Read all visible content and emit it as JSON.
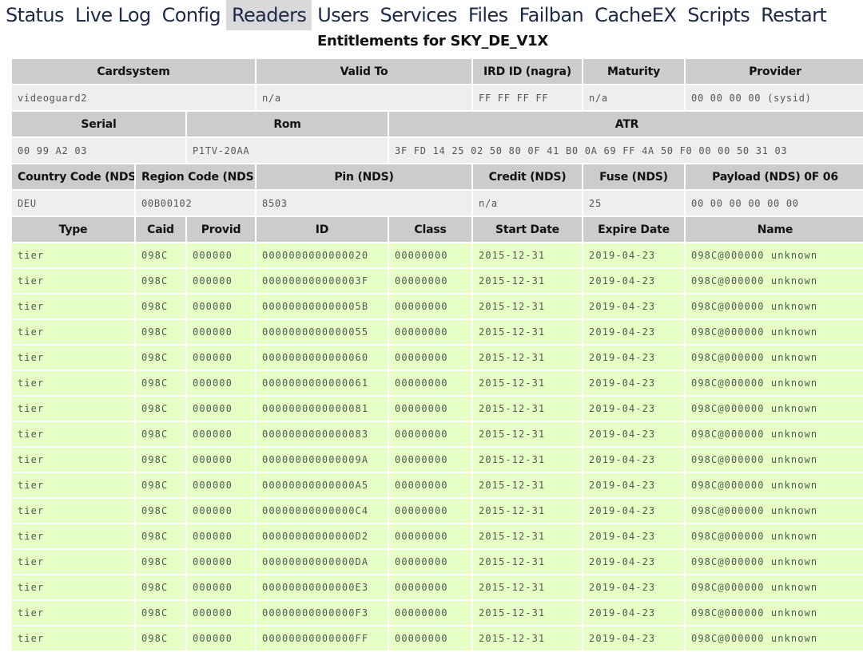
{
  "menu": [
    {
      "label": "Status",
      "active": false
    },
    {
      "label": "Live Log",
      "active": false
    },
    {
      "label": "Config",
      "active": false
    },
    {
      "label": "Readers",
      "active": true
    },
    {
      "label": "Users",
      "active": false
    },
    {
      "label": "Services",
      "active": false
    },
    {
      "label": "Files",
      "active": false
    },
    {
      "label": "Failban",
      "active": false
    },
    {
      "label": "CacheEX",
      "active": false
    },
    {
      "label": "Scripts",
      "active": false
    },
    {
      "label": "Restart",
      "active": false
    }
  ],
  "title": "Entitlements for SKY_DE_V1X",
  "card_info": {
    "h_cardsystem": "Cardsystem",
    "h_valid_to": "Valid To",
    "h_ird_id": "IRD ID (nagra)",
    "h_maturity": "Maturity",
    "h_provider": "Provider",
    "cardsystem": "videoguard2",
    "valid_to": "n/a",
    "ird_id": "FF FF FF FF",
    "maturity": "n/a",
    "provider": "00 00 00 00 (sysid)",
    "h_serial": "Serial",
    "h_rom": "Rom",
    "h_atr": "ATR",
    "serial": "00 99 A2 03",
    "rom": "P1TV-20AA",
    "atr": "3F FD 14 25 02 50 80 0F 41 B0 0A 69 FF 4A 50 F0 00 00 50 31 03",
    "h_country": "Country Code (NDS)",
    "h_region": "Region Code (NDS)",
    "h_pin": "Pin (NDS)",
    "h_credit": "Credit (NDS)",
    "h_fuse": "Fuse (NDS)",
    "h_payload": "Payload (NDS) 0F 06",
    "country": "DEU",
    "region": "00B00102",
    "pin": "8503",
    "credit": "n/a",
    "fuse": "25",
    "payload": "00 00 00 00 00 00"
  },
  "entitlements": {
    "columns": [
      "Type",
      "Caid",
      "Provid",
      "ID",
      "Class",
      "Start Date",
      "Expire Date",
      "Name"
    ],
    "rows": [
      [
        "tier",
        "098C",
        "000000",
        "0000000000000020",
        "00000000",
        "2015-12-31",
        "2019-04-23",
        "098C@000000 unknown"
      ],
      [
        "tier",
        "098C",
        "000000",
        "000000000000003F",
        "00000000",
        "2015-12-31",
        "2019-04-23",
        "098C@000000 unknown"
      ],
      [
        "tier",
        "098C",
        "000000",
        "000000000000005B",
        "00000000",
        "2015-12-31",
        "2019-04-23",
        "098C@000000 unknown"
      ],
      [
        "tier",
        "098C",
        "000000",
        "0000000000000055",
        "00000000",
        "2015-12-31",
        "2019-04-23",
        "098C@000000 unknown"
      ],
      [
        "tier",
        "098C",
        "000000",
        "0000000000000060",
        "00000000",
        "2015-12-31",
        "2019-04-23",
        "098C@000000 unknown"
      ],
      [
        "tier",
        "098C",
        "000000",
        "0000000000000061",
        "00000000",
        "2015-12-31",
        "2019-04-23",
        "098C@000000 unknown"
      ],
      [
        "tier",
        "098C",
        "000000",
        "0000000000000081",
        "00000000",
        "2015-12-31",
        "2019-04-23",
        "098C@000000 unknown"
      ],
      [
        "tier",
        "098C",
        "000000",
        "0000000000000083",
        "00000000",
        "2015-12-31",
        "2019-04-23",
        "098C@000000 unknown"
      ],
      [
        "tier",
        "098C",
        "000000",
        "000000000000009A",
        "00000000",
        "2015-12-31",
        "2019-04-23",
        "098C@000000 unknown"
      ],
      [
        "tier",
        "098C",
        "000000",
        "00000000000000A5",
        "00000000",
        "2015-12-31",
        "2019-04-23",
        "098C@000000 unknown"
      ],
      [
        "tier",
        "098C",
        "000000",
        "00000000000000C4",
        "00000000",
        "2015-12-31",
        "2019-04-23",
        "098C@000000 unknown"
      ],
      [
        "tier",
        "098C",
        "000000",
        "00000000000000D2",
        "00000000",
        "2015-12-31",
        "2019-04-23",
        "098C@000000 unknown"
      ],
      [
        "tier",
        "098C",
        "000000",
        "00000000000000DA",
        "00000000",
        "2015-12-31",
        "2019-04-23",
        "098C@000000 unknown"
      ],
      [
        "tier",
        "098C",
        "000000",
        "00000000000000E3",
        "00000000",
        "2015-12-31",
        "2019-04-23",
        "098C@000000 unknown"
      ],
      [
        "tier",
        "098C",
        "000000",
        "00000000000000F3",
        "00000000",
        "2015-12-31",
        "2019-04-23",
        "098C@000000 unknown"
      ],
      [
        "tier",
        "098C",
        "000000",
        "00000000000000FF",
        "00000000",
        "2015-12-31",
        "2019-04-23",
        "098C@000000 unknown"
      ]
    ]
  },
  "colors": {
    "header_bg": "#cccccc",
    "info_bg": "#eeeeee",
    "entitlement_bg": "#e5ffc5",
    "menu_active_bg": "#d9d9d9",
    "menu_text": "#1d2b4a"
  }
}
